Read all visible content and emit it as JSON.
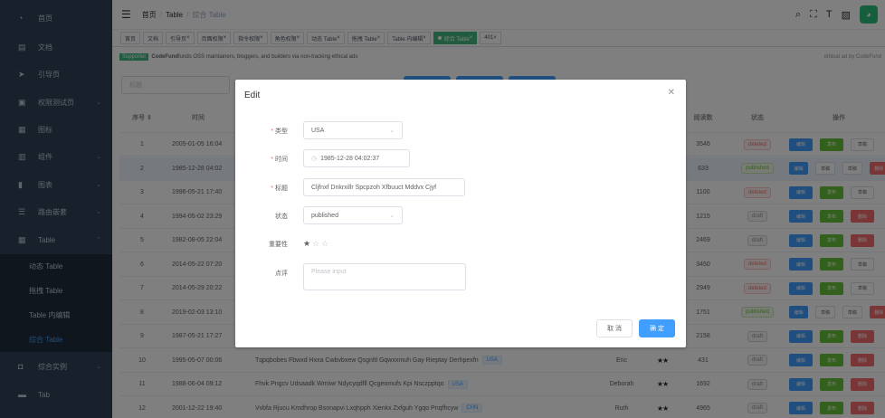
{
  "sidebar": {
    "items": [
      {
        "label": "首页",
        "icon": "dashboard-icon",
        "glyph": "◔"
      },
      {
        "label": "文档",
        "icon": "document-icon",
        "glyph": "▤"
      },
      {
        "label": "引导页",
        "icon": "guide-icon",
        "glyph": "➤"
      },
      {
        "label": "权限测试页",
        "icon": "lock-icon",
        "glyph": "▣"
      },
      {
        "label": "图标",
        "icon": "icon-icon",
        "glyph": "▦"
      },
      {
        "label": "组件",
        "icon": "component-icon",
        "glyph": "▥"
      },
      {
        "label": "图表",
        "icon": "chart-icon",
        "glyph": "▮"
      },
      {
        "label": "路由嵌套",
        "icon": "nested-icon",
        "glyph": "☰"
      },
      {
        "label": "Table",
        "icon": "table-icon",
        "glyph": "▦"
      }
    ],
    "subitems": [
      "动态 Table",
      "拖拽 Table",
      "Table 内编辑",
      "综合 Table"
    ],
    "bottom": [
      {
        "label": "综合实例",
        "icon": "example-icon",
        "glyph": "◘"
      },
      {
        "label": "Tab",
        "icon": "tab-icon",
        "glyph": "▬"
      }
    ]
  },
  "navbar": {
    "breadcrumb": [
      "首页",
      "Table",
      "综合 Table"
    ],
    "icons": [
      "search-icon",
      "fullscreen-icon",
      "size-icon",
      "i18n-icon"
    ]
  },
  "tags": [
    "首页",
    "文档",
    "引导页",
    "页面权限",
    "指令权限",
    "角色权限",
    "动态 Table",
    "拖拽 Table",
    "Table 内编辑",
    "综合 Table",
    "401"
  ],
  "ad": {
    "badge": "Supporter",
    "text": "CodeFund",
    "rest": " funds OSS maintainers, bloggers, and builders via non-tracking ethical ads",
    "right": "ethical ad by CodeFund"
  },
  "filter": {
    "placeholder": "标题"
  },
  "table": {
    "headers": [
      "序号",
      "时间",
      "",
      "",
      "阅读数",
      "状态",
      "操作"
    ],
    "rows": [
      {
        "id": "1",
        "time": "2005-01-05 16:04",
        "title": "",
        "type": "",
        "author": "",
        "stars": "",
        "reads": "3546",
        "status": "deleted"
      },
      {
        "id": "2",
        "time": "1985-12-28 04:02",
        "title": "",
        "type": "",
        "author": "",
        "stars": "",
        "reads": "633",
        "status": "published"
      },
      {
        "id": "3",
        "time": "1996-05-21 17:40",
        "title": "",
        "type": "",
        "author": "",
        "stars": "",
        "reads": "1100",
        "status": "deleted"
      },
      {
        "id": "4",
        "time": "1994-05-02 23:29",
        "title": "",
        "type": "",
        "author": "",
        "stars": "",
        "reads": "1215",
        "status": "draft"
      },
      {
        "id": "5",
        "time": "1982-08-05 22:04",
        "title": "",
        "type": "",
        "author": "",
        "stars": "",
        "reads": "2469",
        "status": "draft"
      },
      {
        "id": "6",
        "time": "2014-05-22 07:20",
        "title": "",
        "type": "",
        "author": "",
        "stars": "",
        "reads": "3450",
        "status": "deleted"
      },
      {
        "id": "7",
        "time": "2014-05-29 20:22",
        "title": "",
        "type": "",
        "author": "",
        "stars": "",
        "reads": "2949",
        "status": "deleted"
      },
      {
        "id": "8",
        "time": "2019-02-03 13:10",
        "title": "",
        "type": "",
        "author": "",
        "stars": "",
        "reads": "1751",
        "status": "published"
      },
      {
        "id": "9",
        "time": "1987-05-21 17:27",
        "title": "",
        "type": "",
        "author": "",
        "stars": "",
        "reads": "2158",
        "status": "draft"
      },
      {
        "id": "10",
        "time": "1995-05-07 00:06",
        "title": "Tqpqbobes Fbwxd Hxxa Cwbvbxew Qsgnltl Gqwxxmuh Gay Rieptay Derhpexfn",
        "type": "USA",
        "author": "Eric",
        "stars": "★★",
        "reads": "431",
        "status": "draft"
      },
      {
        "id": "11",
        "time": "1988-06-04 09:12",
        "title": "Fhvk Pngcv Udsaadk Wmiwr Ndycyqdfll Qcgeomufs Kpi Nsczpptqo",
        "type": "USA",
        "author": "Deborah",
        "stars": "★★",
        "reads": "1692",
        "status": "draft"
      },
      {
        "id": "12",
        "time": "2001-12-22 19:40",
        "title": "Vvbfa Rjucu Kmdhrop Bsonapvi Lxqhpph Xienkx Zxfguh Ygqo Pnqfhcyw",
        "type": "CHN",
        "author": "Ruth",
        "stars": "★★",
        "reads": "4965",
        "status": "draft"
      }
    ],
    "actions": {
      "edit": "编辑",
      "publish": "发布",
      "draft": "草稿",
      "delete": "删除"
    }
  },
  "dialog": {
    "title": "Edit",
    "labels": {
      "type": "类型",
      "time": "时间",
      "title": "标题",
      "status": "状态",
      "importance": "重要性",
      "remark": "点评"
    },
    "values": {
      "type": "USA",
      "time": "1985-12-28 04:02:37",
      "title": "Cljfnxf Dnkrxillr Spcpzoh Xfbuuct Mddvx Cjyf",
      "status": "published"
    },
    "importance": 1,
    "remark_placeholder": "Please input",
    "cancel": "取 消",
    "confirm": "确 定"
  }
}
